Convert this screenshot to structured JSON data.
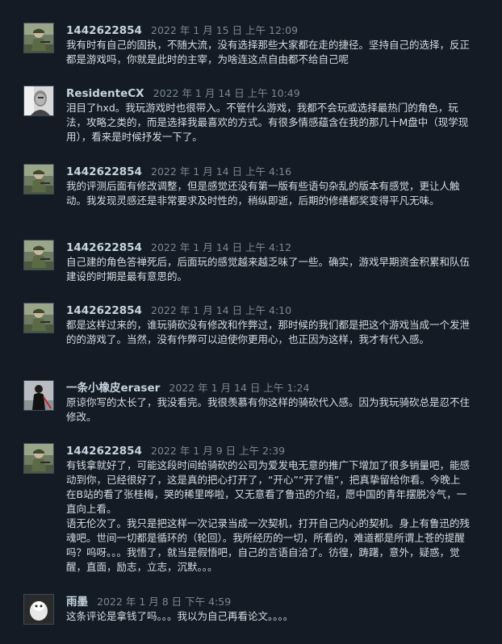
{
  "comments": [
    {
      "avatar": "soldier-avatar",
      "author": "1442622854",
      "time": "2022 年 1 月 15 日 上午 12:09",
      "text": "我有时有自己的固执，不随大流，没有选择那些大家都在走的捷径。坚持自己的选择，反正都是游戏吗，你就是此时的主宰，为啥连这点自由都不给自己呢"
    },
    {
      "avatar": "bw-portrait-avatar",
      "author": "ResidenteCX",
      "time": "2022 年 1 月 14 日 上午 10:49",
      "text": "泪目了hxd。我玩游戏时也很带入。不管什么游戏，我都不会玩或选择最热门的角色，玩法，攻略之类的，而是选择我最喜欢的方式。有很多情感蕴含在我的那几十M盘中（现学现用），看来是时候抒发一下了。"
    },
    {
      "avatar": "soldier-avatar",
      "author": "1442622854",
      "time": "2022 年 1 月 14 日 上午 4:16",
      "text": "我的评测后面有修改调整，但是感觉还没有第一版有些语句杂乱的版本有感觉，更让人触动。我发现灵感还是非常要求及时性的，稍纵即逝，后期的修缮都奖变得平凡无味。"
    },
    {
      "avatar": "soldier-avatar",
      "author": "1442622854",
      "time": "2022 年 1 月 14 日 上午 4:12",
      "text": "自己建的角色答禅死后，后面玩的感觉越来越乏味了一些。确实，游戏早期资金积累和队伍建设的时期是最有意思的。"
    },
    {
      "avatar": "soldier-avatar",
      "author": "1442622854",
      "time": "2022 年 1 月 14 日 上午 4:10",
      "text": "都是这样过来的，谁玩骑砍没有修改和作弊过，那时候的我们都是把这个游戏当成一个发泄的的游戏了。当然，没有作弊可以迫使你更用心，也正因为这样，我才有代入感。"
    },
    {
      "avatar": "dark-knight-avatar",
      "author": "一条小橡皮eraser",
      "time": "2022 年 1 月 14 日 上午 1:24",
      "text": "原谅你写的太长了，我没看完。我很羡慕有你这样的骑砍代入感。因为我玩骑砍总是忍不住修改。"
    },
    {
      "avatar": "soldier-avatar",
      "author": "1442622854",
      "time": "2022 年 1 月 9 日 上午 2:39",
      "text": "有钱拿就好了，可能这段时间给骑砍的公司为爱发电无意的推广下增加了很多销量吧，能感动到你，已经很好了，这是真的把心打开了，“开心”“开了悟”，把真挚留给你看。今晚上在B站的看了张桂梅，哭的稀里哗啦，又无意看了鲁迅的介绍，愿中国的青年摆脱冷气，一直向上看。\n语无伦次了。我只是把这样一次记录当成一次契机，打开自己内心的契机。身上有鲁迅的残魂吧。世间一切都是循环的（轮回）。我所经历的一切，所看的，难道都是所谓上苍的提醒吗？呜呀。。。我悟了，就当是假悟吧，自己的言语自洽了。彷徨，踌躇，意外，疑惑，觉醒，直面，励志，立志，沉默。。。"
    },
    {
      "avatar": "white-creature-avatar",
      "author": "雨墨",
      "time": "2022 年 1 月 8 日 下午 4:59",
      "text": "这条评论是拿钱了吗。。。我以为自己再看论文。。。。"
    }
  ]
}
